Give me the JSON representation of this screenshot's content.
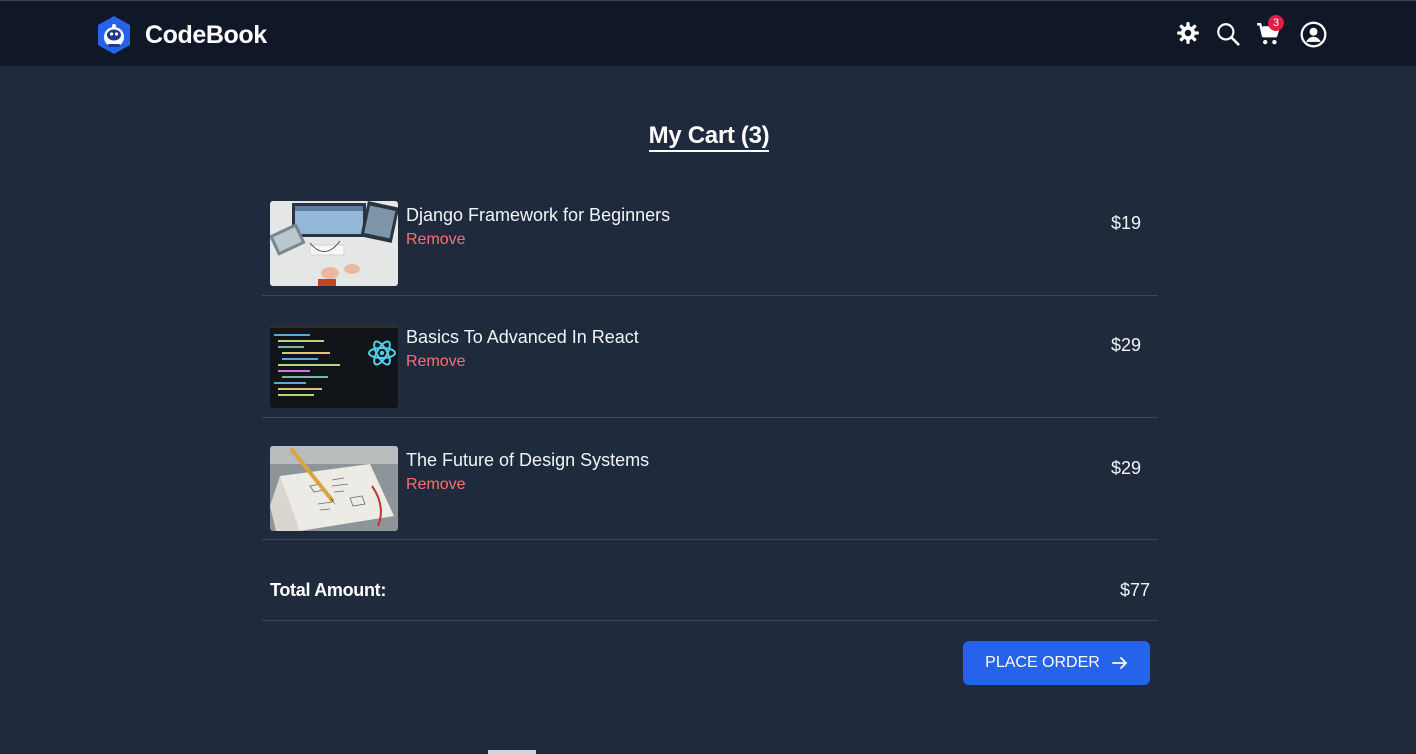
{
  "brand": {
    "name": "CodeBook",
    "logo_icon": "astronaut-logo-icon"
  },
  "nav": {
    "icons": [
      "gear-icon",
      "search-icon",
      "cart-icon",
      "user-icon"
    ],
    "cart_count": "3"
  },
  "page": {
    "title": "My Cart (3)"
  },
  "cart": {
    "items": [
      {
        "title": "Django Framework for Beginners",
        "remove_label": "Remove",
        "price": "$19",
        "image": "desk-computers-photo"
      },
      {
        "title": "Basics To Advanced In React",
        "remove_label": "Remove",
        "price": "$29",
        "image": "react-code-photo"
      },
      {
        "title": "The Future of Design Systems",
        "remove_label": "Remove",
        "price": "$29",
        "image": "sketchbook-pencil-photo"
      }
    ],
    "total_label": "Total Amount:",
    "total_value": "$77"
  },
  "actions": {
    "place_order_label": "PLACE ORDER"
  },
  "colors": {
    "background": "#1f2a3c",
    "header": "#101828",
    "accent": "#2563eb",
    "remove": "#f87171",
    "badge": "#e11d48"
  }
}
